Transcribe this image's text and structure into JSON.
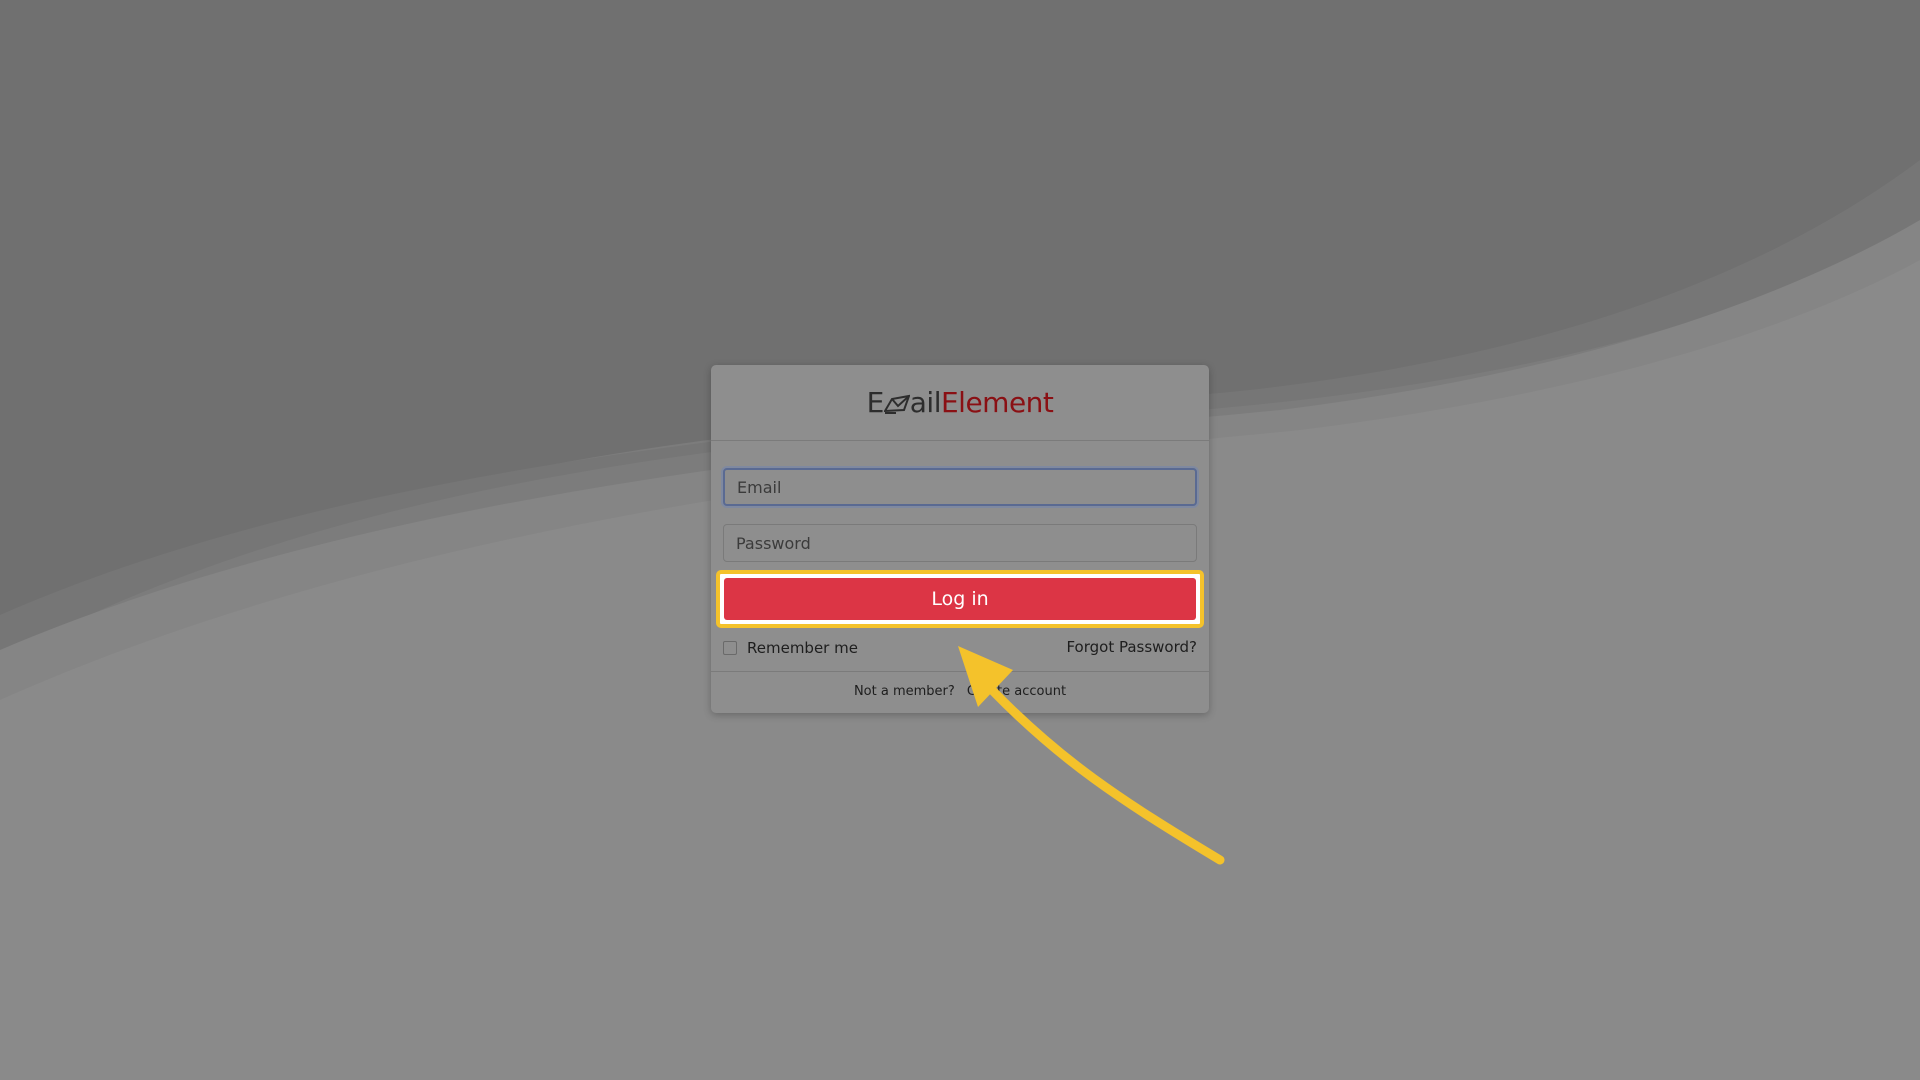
{
  "logo": {
    "part1": "E",
    "part2": "ail",
    "part3": "Element",
    "icon": "envelope-icon"
  },
  "form": {
    "email_placeholder": "Email",
    "password_placeholder": "Password",
    "login_label": "Log in",
    "remember_label": "Remember me",
    "remember_checked": false,
    "forgot_label": "Forgot Password?"
  },
  "footer": {
    "prompt": "Not a member?",
    "create_label": "Create account"
  },
  "colors": {
    "login_button": "#dc3545",
    "highlight": "#f4c22b",
    "brand_red": "#8a1014"
  },
  "annotation": {
    "arrow_icon": "yellow-arrow-icon"
  }
}
